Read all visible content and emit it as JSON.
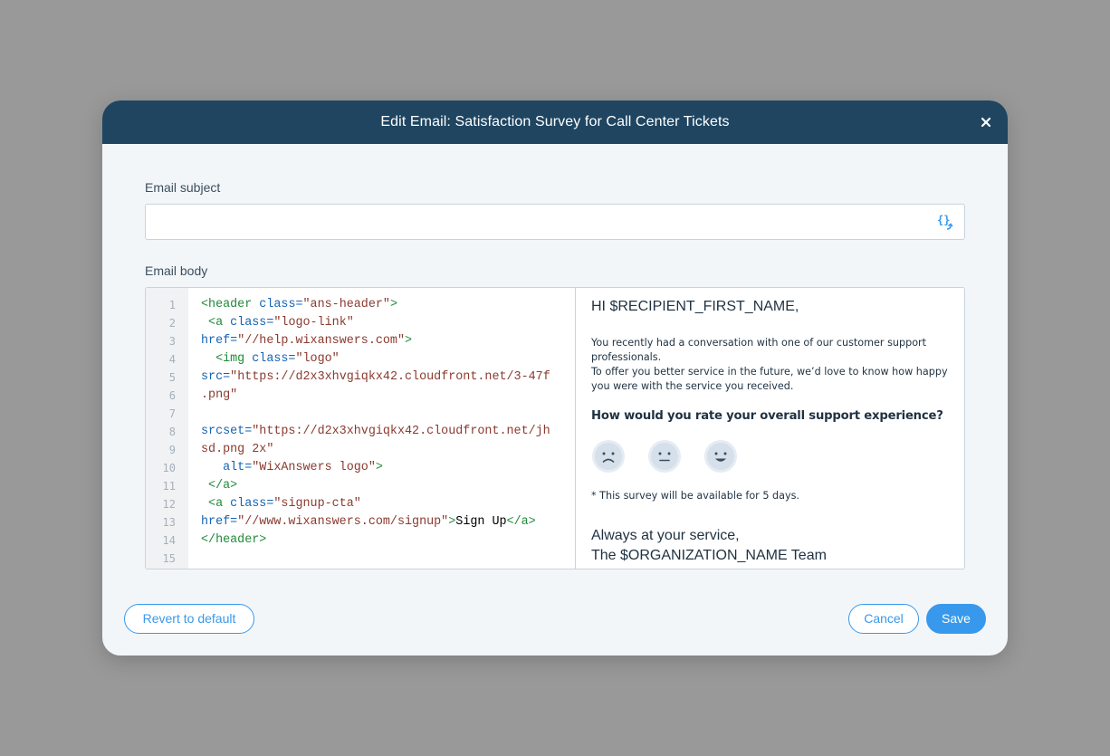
{
  "dialog": {
    "title": "Edit Email: Satisfaction Survey for Call Center Tickets",
    "close_icon": "close-icon"
  },
  "subject": {
    "label": "Email subject",
    "value": "",
    "placeholder": "",
    "variable_icon": "curly-braces-insert-icon"
  },
  "body": {
    "label": "Email body",
    "line_numbers": [
      "1",
      "2",
      "3",
      "4",
      "5",
      "6",
      "7",
      "8",
      "9",
      "10",
      "11",
      "12",
      "13",
      "14",
      "15"
    ],
    "code": {
      "l1": {
        "a": "<header ",
        "b": "class=",
        "c": "\"ans-header\"",
        "d": ">"
      },
      "l2": {
        "a": " <a ",
        "b": "class=",
        "c": "\"logo-link\""
      },
      "l3": {
        "a": "href=",
        "b": "\"//help.wixanswers.com\"",
        "c": ">"
      },
      "l4": {
        "a": "  <img ",
        "b": "class=",
        "c": "\"logo\""
      },
      "l5": {
        "a": "src=",
        "b": "\"https://d2x3xhvgiqkx42.cloudfront.net/3-47f"
      },
      "l6": {
        "a": ".png\""
      },
      "l8": {
        "a": "srcset=",
        "b": "\"https://d2x3xhvgiqkx42.cloudfront.net/jh"
      },
      "l9": {
        "a": "sd.png 2x\""
      },
      "l10": {
        "a": "   alt=",
        "b": "\"WixAnswers logo\"",
        "c": ">"
      },
      "l11": {
        "a": " </a>"
      },
      "l12": {
        "a": " <a ",
        "b": "class=",
        "c": "\"signup-cta\""
      },
      "l13": {
        "a": "href=",
        "b": "\"//www.wixanswers.com/signup\"",
        "c": ">",
        "d": "Sign Up",
        "e": "</a>"
      },
      "l14": {
        "a": "</header>"
      }
    }
  },
  "preview": {
    "greeting": "HI $RECIPIENT_FIRST_NAME,",
    "para1": "You recently had a conversation with one of our customer support professionals.",
    "para2": "To offer you better service in the future, we’d love to know how happy you were with the service you received.",
    "question": "How would you rate your overall support experience?",
    "faces": [
      "sad-face-icon",
      "neutral-face-icon",
      "happy-face-icon"
    ],
    "note": "* This survey will be available for 5 days.",
    "sign1": "Always at your service,",
    "sign2": "The $ORGANIZATION_NAME Team"
  },
  "footer": {
    "revert_label": "Revert to default",
    "cancel_label": "Cancel",
    "save_label": "Save"
  },
  "colors": {
    "header_bg": "#1f4561",
    "accent": "#3899ec",
    "dialog_bg": "#f3f6f9"
  }
}
